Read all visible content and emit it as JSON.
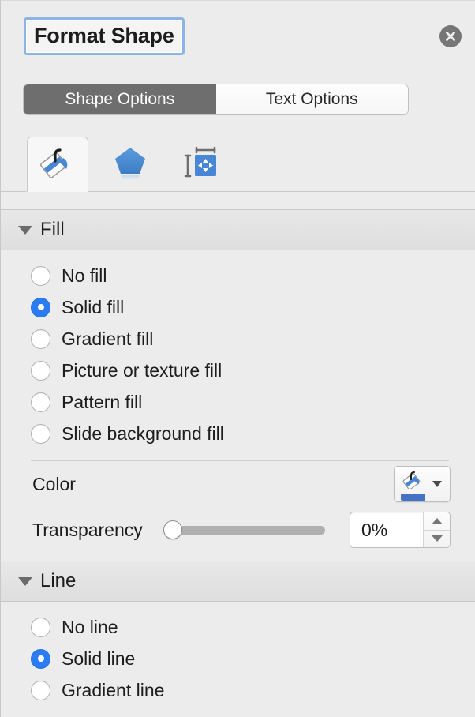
{
  "panel": {
    "title": "Format Shape",
    "close_icon": "close-circle-icon"
  },
  "tabs": {
    "shape_options": "Shape Options",
    "text_options": "Text Options",
    "active": "Shape Options"
  },
  "icon_tabs": [
    {
      "name": "fill-and-line-icon",
      "label": "Fill & Line",
      "selected": true
    },
    {
      "name": "effects-pentagon-icon",
      "label": "Effects",
      "selected": false
    },
    {
      "name": "size-and-properties-icon",
      "label": "Size & Properties",
      "selected": false
    }
  ],
  "fill_section": {
    "title": "Fill",
    "expanded": true,
    "options": [
      {
        "label": "No fill",
        "selected": false
      },
      {
        "label": "Solid fill",
        "selected": true
      },
      {
        "label": "Gradient fill",
        "selected": false
      },
      {
        "label": "Picture or texture fill",
        "selected": false
      },
      {
        "label": "Pattern fill",
        "selected": false
      },
      {
        "label": "Slide background fill",
        "selected": false
      }
    ],
    "color": {
      "label": "Color",
      "swatch_hex": "#4472C4",
      "icon": "paint-bucket-icon",
      "caret": "chevron-down-icon"
    },
    "transparency": {
      "label": "Transparency",
      "value": "0%",
      "percent": 0
    }
  },
  "line_section": {
    "title": "Line",
    "expanded": true,
    "options": [
      {
        "label": "No line",
        "selected": false
      },
      {
        "label": "Solid line",
        "selected": true
      },
      {
        "label": "Gradient line",
        "selected": false
      }
    ]
  },
  "colors": {
    "accent_blue": "#2b7bf3",
    "swatch_blue": "#4472C4",
    "active_tab_gray": "#6e6e6e",
    "panel_bg": "#ececec"
  }
}
